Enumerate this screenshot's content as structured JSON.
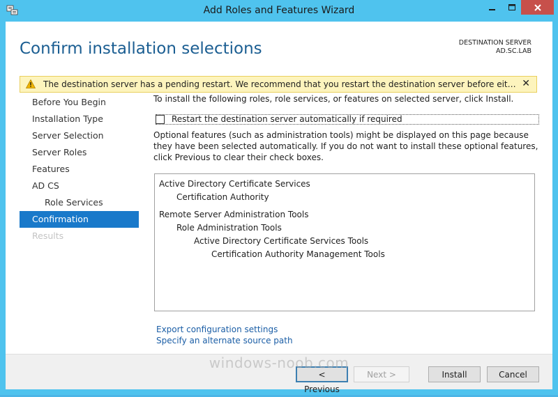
{
  "window": {
    "title": "Add Roles and Features Wizard"
  },
  "header": {
    "page_title": "Confirm installation selections",
    "destination_label": "DESTINATION SERVER",
    "destination_value": "AD.SC.LAB"
  },
  "warning": {
    "text": "The destination server has a pending restart. We recommend that you restart the destination server before either installing o...",
    "close_label": "✕"
  },
  "nav": {
    "items": [
      {
        "label": "Before You Begin"
      },
      {
        "label": "Installation Type"
      },
      {
        "label": "Server Selection"
      },
      {
        "label": "Server Roles"
      },
      {
        "label": "Features"
      },
      {
        "label": "AD CS"
      },
      {
        "label": "Role Services"
      },
      {
        "label": "Confirmation"
      },
      {
        "label": "Results"
      }
    ]
  },
  "content": {
    "intro": "To install the following roles, role services, or features on selected server, click Install.",
    "restart_checkbox_label": "Restart the destination server automatically if required",
    "optional_text": "Optional features (such as administration tools) might be displayed on this page because they have been selected automatically. If you do not want to install these optional features, click Previous to clear their check boxes.",
    "features": [
      "Active Directory Certificate Services",
      "Certification Authority",
      "Remote Server Administration Tools",
      "Role Administration Tools",
      "Active Directory Certificate Services Tools",
      "Certification Authority Management Tools"
    ],
    "links": {
      "export": "Export configuration settings",
      "alternate": "Specify an alternate source path"
    }
  },
  "footer": {
    "previous": "< Previous",
    "next": "Next >",
    "install": "Install",
    "cancel": "Cancel"
  },
  "watermark": "windows-noob.com"
}
